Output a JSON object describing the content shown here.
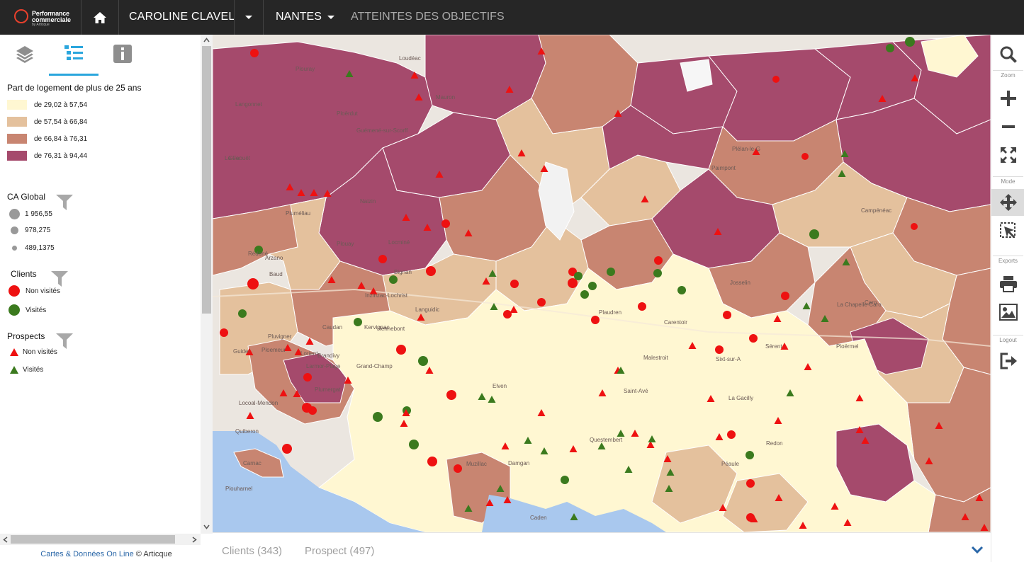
{
  "header": {
    "logo": {
      "line1": "Performance",
      "line2": "commerciale",
      "line3": "by Articque"
    },
    "user_name": "CAROLINE CLAVEL",
    "zone": "NANTES",
    "objectives_tab": "ATTEINTES DES OBJECTIFS"
  },
  "left_panel": {
    "legend_title": "Part de logement de plus de 25 ans",
    "classes": [
      {
        "label": "de 29,02 à 57,54",
        "color": "#fff7d2"
      },
      {
        "label": "de 57,54 à 66,84",
        "color": "#e4c19d"
      },
      {
        "label": "de 66,84 à 76,31",
        "color": "#c88571"
      },
      {
        "label": "de 76,31 à 94,44",
        "color": "#a54a6c"
      }
    ],
    "ca_section": {
      "title": "CA Global",
      "sizes": [
        {
          "label": "1 956,55"
        },
        {
          "label": "978,275"
        },
        {
          "label": "489,1375"
        }
      ]
    },
    "clients_section": {
      "title": "Clients",
      "items": [
        {
          "label": "Non visités",
          "color": "#ee1111"
        },
        {
          "label": "Visités",
          "color": "#3b7a1e"
        }
      ]
    },
    "prospects_section": {
      "title": "Prospects",
      "items": [
        {
          "label": "Non visités",
          "color": "#ee1111"
        },
        {
          "label": "Visités",
          "color": "#3b7a1e"
        }
      ]
    },
    "credits": {
      "link": "Cartes & Données On Line",
      "owner": "© Articque"
    }
  },
  "map": {
    "labels": [
      "Loudéac",
      "Plouray",
      "Langonnet",
      "Ploërdut",
      "Guémené-sur-Scorff",
      "Mauron",
      "Guer",
      "Paimpont",
      "Plélan-le-G",
      "Pluméliau",
      "Naizin",
      "Locminé",
      "Baud",
      "Bignan",
      "Arzano",
      "Plouay",
      "Inzinzac-Lochrist",
      "Hennebont",
      "Caudan",
      "Languidic",
      "Pluvigner",
      "Brandivy",
      "Grand-Champ",
      "Elven",
      "Questembert",
      "Malestroit",
      "Carentoir",
      "Sixt-sur-A",
      "La Gacilly",
      "Redon",
      "Plumergat",
      "Locoal-Mendon",
      "Carnac",
      "Plouharnel",
      "Quiberon",
      "Rédené",
      "Guidel",
      "Ploemeur",
      "Lorient",
      "Larmor-Plage",
      "Kervignac",
      "Muzillac",
      "Damgan",
      "Caden",
      "Péaule",
      "Saint-Avé",
      "Plaudren",
      "Sérent",
      "Ploërmel",
      "Campénéac",
      "Caro",
      "La Chapelle-Caro",
      "Josselin",
      "Le Faouët"
    ]
  },
  "bottom": {
    "clients_tab": "Clients (343)",
    "prospects_tab": "Prospect (497)"
  },
  "toolbar": {
    "zoom_label": "Zoom",
    "mode_label": "Mode",
    "exports_label": "Exports",
    "logout_label": "Logout"
  }
}
